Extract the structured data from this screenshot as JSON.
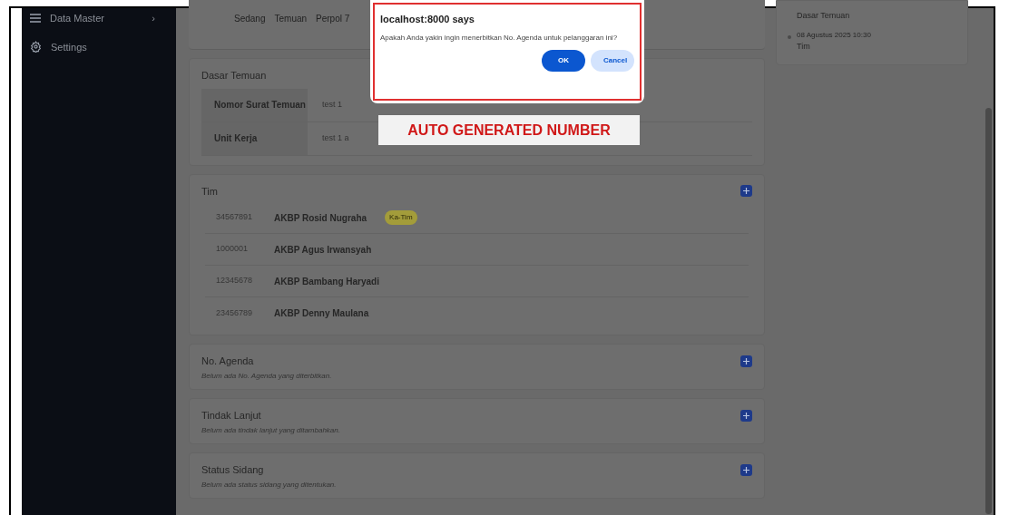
{
  "sidebar": {
    "items": [
      {
        "label": "Data Master",
        "chevron": "›"
      },
      {
        "label": "Settings"
      }
    ]
  },
  "top_card": {
    "texts": [
      "Sedang",
      "Temuan",
      "Perpol 7"
    ]
  },
  "dasar_temuan": {
    "title": "Dasar Temuan",
    "rows": [
      {
        "label": "Nomor Surat Temuan",
        "value": "test 1"
      },
      {
        "label": "Unit Kerja",
        "value": "test 1 a"
      }
    ]
  },
  "tim": {
    "title": "Tim",
    "members": [
      {
        "nrp": "34567891",
        "name": "AKBP Rosid Nugraha",
        "badge": "Ka-Tim"
      },
      {
        "nrp": "1000001",
        "name": "AKBP Agus Irwansyah"
      },
      {
        "nrp": "12345678",
        "name": "AKBP Bambang Haryadi"
      },
      {
        "nrp": "23456789",
        "name": "AKBP Denny Maulana"
      }
    ]
  },
  "sections": [
    {
      "title": "No. Agenda",
      "empty_text": "Belum ada No. Agenda yang diterbitkan."
    },
    {
      "title": "Tindak Lanjut",
      "empty_text": "Belum ada tindak lanjut yang ditambahkan."
    },
    {
      "title": "Status Sidang",
      "empty_text": "Belum ada status sidang yang ditentukan."
    }
  ],
  "timeline": {
    "items": [
      {
        "title": "Dasar Temuan"
      },
      {
        "date": "08 Agustus 2025 10:30",
        "title": "Tim"
      }
    ]
  },
  "dialog": {
    "title": "localhost:8000 says",
    "message": "Apakah Anda yakin ingin menerbitkan No. Agenda untuk pelanggaran ini?",
    "buttons": [
      {
        "label": "OK",
        "primary": true
      },
      {
        "label": "Cancel",
        "primary": false
      }
    ]
  },
  "annotation": {
    "text": "AUTO GENERATED NUMBER"
  }
}
